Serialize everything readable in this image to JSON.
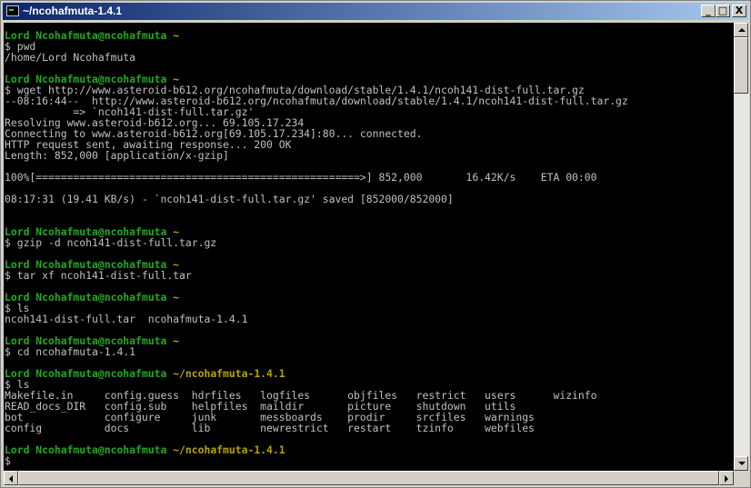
{
  "window": {
    "title": "~/ncohafmuta-1.4.1",
    "controls": {
      "minimize": "_",
      "maximize": "□",
      "close": "X"
    }
  },
  "colors": {
    "prompt": "#1faa1f",
    "output": "#c0c0c0",
    "path": "#b5a400",
    "background": "#000000"
  },
  "terminal": {
    "lines": [
      {
        "type": "prompt",
        "user": "Lord Ncohafmuta@ncohafmuta",
        "path": "~"
      },
      {
        "type": "output",
        "text": "$ pwd"
      },
      {
        "type": "output",
        "text": "/home/Lord Ncohafmuta"
      },
      {
        "type": "blank",
        "text": ""
      },
      {
        "type": "prompt",
        "user": "Lord Ncohafmuta@ncohafmuta",
        "path": "~"
      },
      {
        "type": "output",
        "text": "$ wget http://www.asteroid-b612.org/ncohafmuta/download/stable/1.4.1/ncoh141-dist-full.tar.gz"
      },
      {
        "type": "output",
        "text": "--08:16:44--  http://www.asteroid-b612.org/ncohafmuta/download/stable/1.4.1/ncoh141-dist-full.tar.gz"
      },
      {
        "type": "output",
        "text": "           => `ncoh141-dist-full.tar.gz'"
      },
      {
        "type": "output",
        "text": "Resolving www.asteroid-b612.org... 69.105.17.234"
      },
      {
        "type": "output",
        "text": "Connecting to www.asteroid-b612.org[69.105.17.234]:80... connected."
      },
      {
        "type": "output",
        "text": "HTTP request sent, awaiting response... 200 OK"
      },
      {
        "type": "output",
        "text": "Length: 852,000 [application/x-gzip]"
      },
      {
        "type": "blank",
        "text": ""
      },
      {
        "type": "output",
        "text": "100%[====================================================>] 852,000       16.42K/s    ETA 00:00"
      },
      {
        "type": "blank",
        "text": ""
      },
      {
        "type": "output",
        "text": "08:17:31 (19.41 KB/s) - `ncoh141-dist-full.tar.gz' saved [852000/852000]"
      },
      {
        "type": "blank",
        "text": ""
      },
      {
        "type": "blank",
        "text": ""
      },
      {
        "type": "prompt",
        "user": "Lord Ncohafmuta@ncohafmuta",
        "path": "~"
      },
      {
        "type": "output",
        "text": "$ gzip -d ncoh141-dist-full.tar.gz"
      },
      {
        "type": "blank",
        "text": ""
      },
      {
        "type": "prompt",
        "user": "Lord Ncohafmuta@ncohafmuta",
        "path": "~"
      },
      {
        "type": "output",
        "text": "$ tar xf ncoh141-dist-full.tar"
      },
      {
        "type": "blank",
        "text": ""
      },
      {
        "type": "prompt",
        "user": "Lord Ncohafmuta@ncohafmuta",
        "path": "~"
      },
      {
        "type": "output",
        "text": "$ ls"
      },
      {
        "type": "output",
        "text": "ncoh141-dist-full.tar  ncohafmuta-1.4.1"
      },
      {
        "type": "blank",
        "text": ""
      },
      {
        "type": "prompt",
        "user": "Lord Ncohafmuta@ncohafmuta",
        "path": "~"
      },
      {
        "type": "output",
        "text": "$ cd ncohafmuta-1.4.1"
      },
      {
        "type": "blank",
        "text": ""
      },
      {
        "type": "prompt",
        "user": "Lord Ncohafmuta@ncohafmuta",
        "path": "~/ncohafmuta-1.4.1"
      },
      {
        "type": "output",
        "text": "$ ls"
      },
      {
        "type": "output",
        "text": "Makefile.in     config.guess  hdrfiles   logfiles      objfiles   restrict   users      wizinfo"
      },
      {
        "type": "output",
        "text": "READ_docs_DIR   config.sub    helpfiles  maildir       picture    shutdown   utils"
      },
      {
        "type": "output",
        "text": "bot             configure     junk       messboards    prodir     srcfiles   warnings"
      },
      {
        "type": "output",
        "text": "config          docs          lib        newrestrict   restart    tzinfo     webfiles"
      },
      {
        "type": "blank",
        "text": ""
      },
      {
        "type": "prompt",
        "user": "Lord Ncohafmuta@ncohafmuta",
        "path": "~/ncohafmuta-1.4.1"
      },
      {
        "type": "output",
        "text": "$"
      }
    ]
  }
}
